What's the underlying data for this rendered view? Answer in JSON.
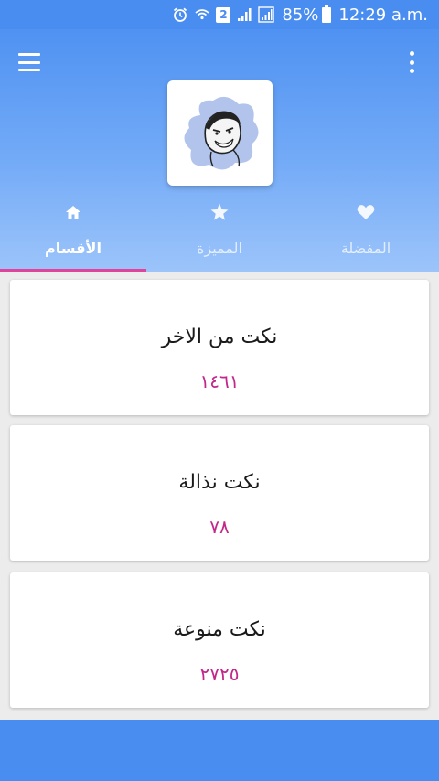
{
  "status_bar": {
    "sim_label": "2",
    "battery": "85%",
    "time": "12:29 a.m."
  },
  "header": {
    "menu_icon": "hamburger-menu-icon",
    "overflow_icon": "more-vert-icon",
    "avatar": "meme-face-avatar"
  },
  "tabs": [
    {
      "label": "المفضلة",
      "icon": "heart-icon",
      "active": false
    },
    {
      "label": "المميزة",
      "icon": "star-icon",
      "active": false
    },
    {
      "label": "الأقسام",
      "icon": "home-icon",
      "active": true
    }
  ],
  "categories": [
    {
      "title": "نكت من الاخر",
      "count": "١٤٦١"
    },
    {
      "title": "نكت نذالة",
      "count": "٧٨"
    },
    {
      "title": "نكت منوعة",
      "count": "٢٧٢٥"
    }
  ],
  "colors": {
    "primary": "#4a8df0",
    "accent": "#e0449a",
    "count": "#c2278a"
  }
}
